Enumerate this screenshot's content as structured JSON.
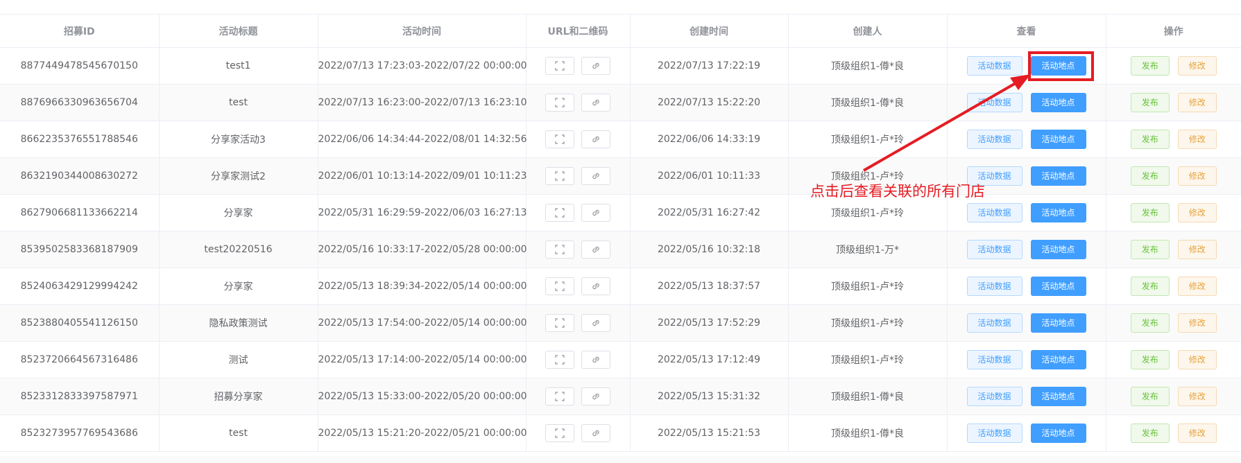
{
  "table": {
    "headers": [
      "招募ID",
      "活动标题",
      "活动时间",
      "URL和二维码",
      "创建时间",
      "创建人",
      "查看",
      "操作"
    ],
    "view_buttons": {
      "data": "活动数据",
      "location": "活动地点"
    },
    "action_buttons": {
      "publish": "发布",
      "edit": "修改"
    },
    "rows": [
      {
        "id": "8877449478545670150",
        "title": "test1",
        "period": "2022/07/13 17:23:03-2022/07/22 00:00:00",
        "created": "2022/07/13 17:22:19",
        "creator": "顶级组织1-僔*良"
      },
      {
        "id": "8876966330963656704",
        "title": "test",
        "period": "2022/07/13 16:23:00-2022/07/13 16:23:10",
        "created": "2022/07/13 15:22:20",
        "creator": "顶级组织1-僔*良"
      },
      {
        "id": "8662235376551788546",
        "title": "分享家活动3",
        "period": "2022/06/06 14:34:44-2022/08/01 14:32:56",
        "created": "2022/06/06 14:33:19",
        "creator": "顶级组织1-卢*玲"
      },
      {
        "id": "8632190344008630272",
        "title": "分享家测试2",
        "period": "2022/06/01 10:13:14-2022/09/01 10:11:23",
        "created": "2022/06/01 10:11:33",
        "creator": "顶级组织1-卢*玲"
      },
      {
        "id": "8627906681133662214",
        "title": "分享家",
        "period": "2022/05/31 16:29:59-2022/06/03 16:27:13",
        "created": "2022/05/31 16:27:42",
        "creator": "顶级组织1-卢*玲"
      },
      {
        "id": "8539502583368187909",
        "title": "test20220516",
        "period": "2022/05/16 10:33:17-2022/05/28 00:00:00",
        "created": "2022/05/16 10:32:18",
        "creator": "顶级组织1-万*"
      },
      {
        "id": "8524063429129994242",
        "title": "分享家",
        "period": "2022/05/13 18:39:34-2022/05/14 00:00:00",
        "created": "2022/05/13 18:37:57",
        "creator": "顶级组织1-卢*玲"
      },
      {
        "id": "8523880405541126150",
        "title": "隐私政策测试",
        "period": "2022/05/13 17:54:00-2022/05/14 00:00:00",
        "created": "2022/05/13 17:52:29",
        "creator": "顶级组织1-卢*玲"
      },
      {
        "id": "8523720664567316486",
        "title": "测试",
        "period": "2022/05/13 17:14:00-2022/05/14 00:00:00",
        "created": "2022/05/13 17:12:49",
        "creator": "顶级组织1-卢*玲"
      },
      {
        "id": "8523312833397587971",
        "title": "招募分享家",
        "period": "2022/05/13 15:33:00-2022/05/20 00:00:00",
        "created": "2022/05/13 15:31:32",
        "creator": "顶级组织1-僔*良"
      },
      {
        "id": "8523273957769543686",
        "title": "test",
        "period": "2022/05/13 15:21:20-2022/05/21 00:00:00",
        "created": "2022/05/13 15:21:53",
        "creator": "顶级组织1-僔*良"
      }
    ]
  },
  "annotation": {
    "text": "点击后查看关联的所有门店"
  },
  "colors": {
    "primary": "#409eff",
    "success": "#67c23a",
    "warning": "#e6a23c",
    "annotation": "#e51c23"
  }
}
